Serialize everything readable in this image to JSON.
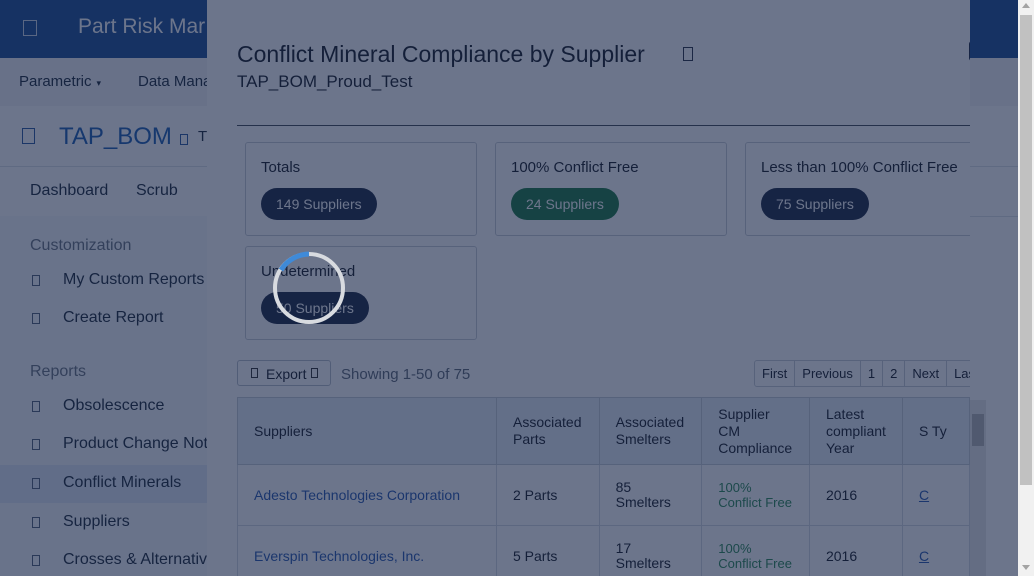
{
  "app": {
    "title": "Part Risk Mar",
    "nav": [
      {
        "label": "Parametric",
        "caret": "▾"
      },
      {
        "label": "Data Mana"
      }
    ],
    "bom": {
      "title": "TAP_BOM",
      "suffix": "T"
    },
    "subnav": [
      "Dashboard",
      "Scrub"
    ],
    "sidebar": {
      "section1": "Customization",
      "section1_items": [
        "My Custom Reports",
        "Create Report"
      ],
      "section2": "Reports",
      "section2_items": [
        "Obsolescence",
        "Product Change Not",
        "Conflict Minerals",
        "Suppliers",
        "Crosses & Alternativ"
      ]
    }
  },
  "modal": {
    "title": "Conflict Mineral Compliance by Supplier",
    "subtitle": "TAP_BOM_Proud_Test",
    "cards": [
      {
        "label": "Totals",
        "pill": "149 Suppliers",
        "color": "#1f2a44"
      },
      {
        "label": "100% Conflict Free",
        "pill": "24 Suppliers",
        "color": "#1f7a45"
      },
      {
        "label": "Less than 100% Conflict Free",
        "pill": "75 Suppliers",
        "color": "#1f2a44"
      },
      {
        "label": "Undetermined",
        "pill": "50 Suppliers",
        "color": "#1f2a44"
      }
    ],
    "export_label": "Export",
    "showing": "Showing 1-50 of 75",
    "pager": [
      "First",
      "Previous",
      "1",
      "2",
      "Next",
      "Last"
    ],
    "table": {
      "headers": [
        "Suppliers",
        "Associated Parts",
        "Associated Smelters",
        "Supplier CM Compliance",
        "Latest compliant Year",
        "S Ty"
      ],
      "rows": [
        [
          "Adesto Technologies Corporation",
          "2 Parts",
          "85 Smelters",
          "100% Conflict Free",
          "2016",
          "C"
        ],
        [
          "Everspin Technologies, Inc.",
          "5 Parts",
          "17 Smelters",
          "100% Conflict Free",
          "2016",
          "C"
        ]
      ]
    }
  }
}
